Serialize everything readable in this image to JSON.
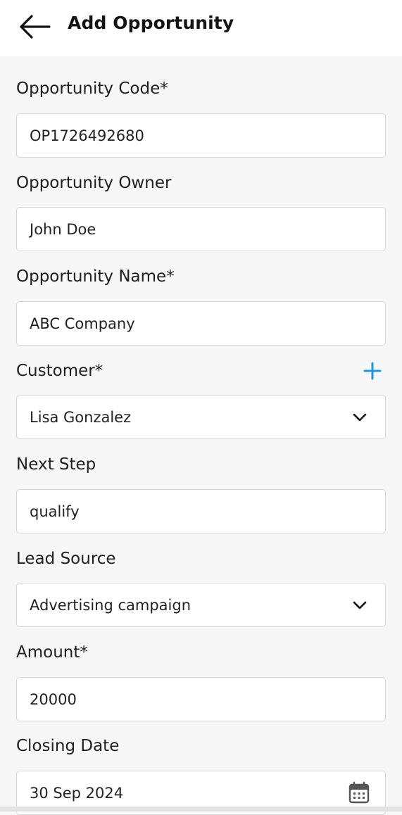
{
  "header": {
    "title": "Add Opportunity"
  },
  "form": {
    "opportunity_code": {
      "label": "Opportunity Code*",
      "value": "OP1726492680"
    },
    "opportunity_owner": {
      "label": "Opportunity Owner",
      "value": "John Doe"
    },
    "opportunity_name": {
      "label": "Opportunity Name*",
      "value": "ABC Company"
    },
    "customer": {
      "label": "Customer*",
      "value": "Lisa Gonzalez"
    },
    "next_step": {
      "label": "Next Step",
      "value": "qualify"
    },
    "lead_source": {
      "label": "Lead Source",
      "value": "Advertising campaign"
    },
    "amount": {
      "label": "Amount*",
      "value": "20000"
    },
    "closing_date": {
      "label": "Closing Date",
      "value": "30 Sep 2024"
    }
  },
  "icons": {
    "back": "arrow-left-icon",
    "add": "plus-icon",
    "dropdown": "chevron-down-icon",
    "calendar": "calendar-icon"
  },
  "colors": {
    "accent": "#1e9be0",
    "background": "#f7f7f7",
    "field_border": "#d6d6d6"
  }
}
